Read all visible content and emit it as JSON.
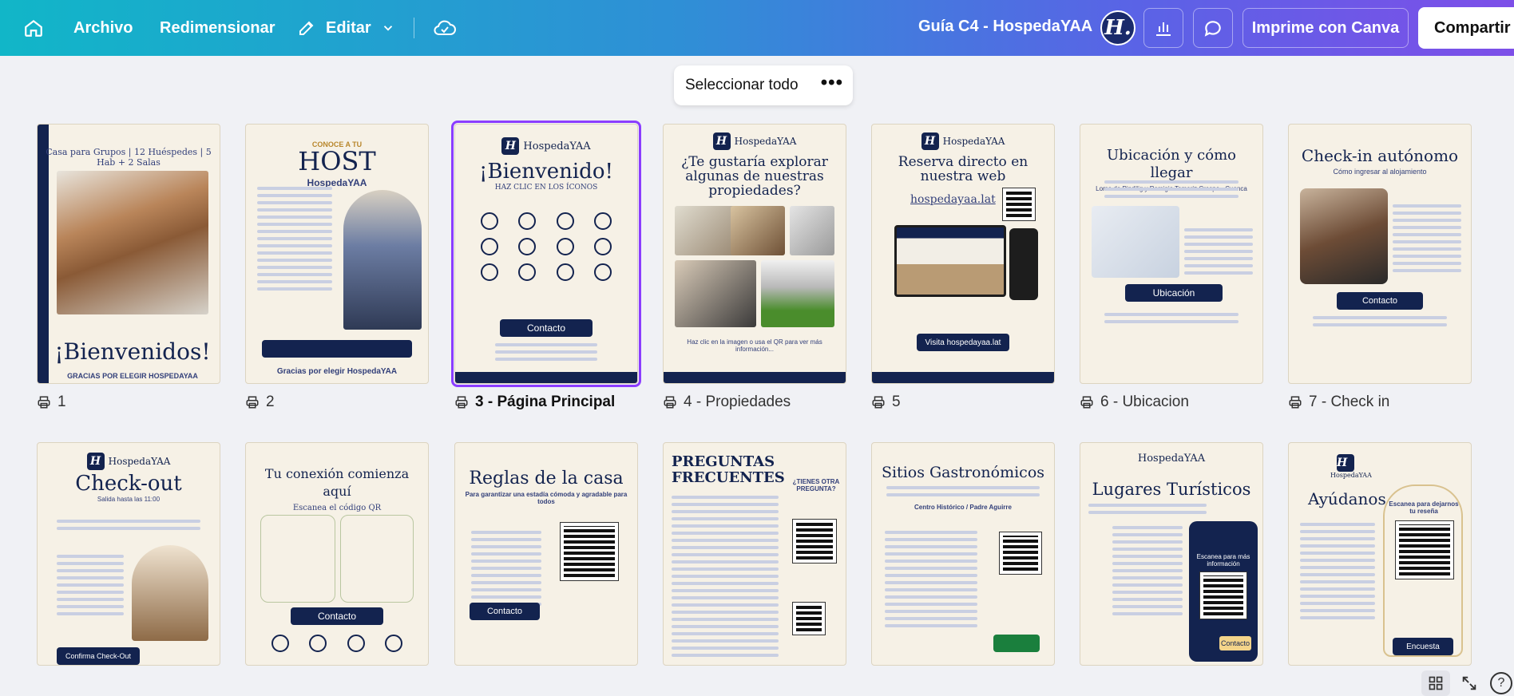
{
  "header": {
    "archivo": "Archivo",
    "redimensionar": "Redimensionar",
    "editar": "Editar",
    "doc_title": "Guía C4 - HospedaYAA",
    "avatar_letter": "H.",
    "print": "Imprime con Canva",
    "share": "Compartir",
    "icons": [
      "home-icon",
      "pencil-icon",
      "chevron-down-icon",
      "cloud-check-icon",
      "bar-chart-icon",
      "comment-icon"
    ]
  },
  "toolbar": {
    "select_all": "Seleccionar todo",
    "more": "•••"
  },
  "pages_row1": [
    {
      "label": "1",
      "bold": false,
      "head": "Casa para Grupos | 12 Huéspedes | 5 Hab + 2 Salas",
      "foot": "¡Bienvenidos!",
      "caption": "GRACIAS POR ELEGIR HOSPEDAYAA"
    },
    {
      "label": "2",
      "bold": false,
      "head": "CONOCE A TU",
      "big": "HOST",
      "sub": "HospedaYAA",
      "foot": "Gracias por elegir HospedaYAA"
    },
    {
      "label": "3 - Página Principal",
      "bold": true,
      "brand": "HospedaYAA",
      "head": "¡Bienvenido!",
      "sub": "HAZ CLIC EN LOS ÍCONOS",
      "cta": "Contacto"
    },
    {
      "label": "4 - Propiedades",
      "bold": false,
      "brand": "HospedaYAA",
      "head": "¿Te gustaría explorar algunas de nuestras propiedades?",
      "foot": "Haz clic en la imagen o usa el QR para ver más información..."
    },
    {
      "label": "5",
      "bold": false,
      "brand": "HospedaYAA",
      "head": "Reserva directo en nuestra web",
      "sub": "hospedayaa.lat",
      "cta": "Visita hospedayaa.lat"
    },
    {
      "label": "6 - Ubicacion",
      "bold": false,
      "head": "Ubicación y cómo llegar",
      "sub": "Loma de Pindilig y Remigio Tamariz Crespo - Cuenca",
      "cta": "Ubicación"
    },
    {
      "label": "7 - Check in",
      "bold": false,
      "head": "Check-in autónomo",
      "sub": "Cómo ingresar al alojamiento",
      "cta": "Contacto"
    }
  ],
  "pages_row2": [
    {
      "brand": "HospedaYAA",
      "head": "Check-out",
      "sub": "Salida hasta las 11:00",
      "cta": "Confirma Check-Out"
    },
    {
      "head": "Tu conexión comienza aquí",
      "sub": "Escanea el código QR",
      "cta": "Contacto"
    },
    {
      "head": "Reglas de la casa",
      "sub": "Para garantizar una estadía cómoda y agradable para todos",
      "cta": "Contacto"
    },
    {
      "head": "PREGUNTAS FRECUENTES",
      "sub": "¿TIENES OTRA PREGUNTA?"
    },
    {
      "head": "Sitios Gastronómicos",
      "sub": "Centro Histórico / Padre Aguirre"
    },
    {
      "brand": "HospedaYAA",
      "head": "Lugares Turísticos",
      "sub": "Escanea para más información",
      "cta": "Contacto"
    },
    {
      "brand": "HospedaYAA",
      "head": "Ayúdanos",
      "sub": "Escanea para dejarnos tu reseña",
      "cta": "Encuesta"
    }
  ]
}
